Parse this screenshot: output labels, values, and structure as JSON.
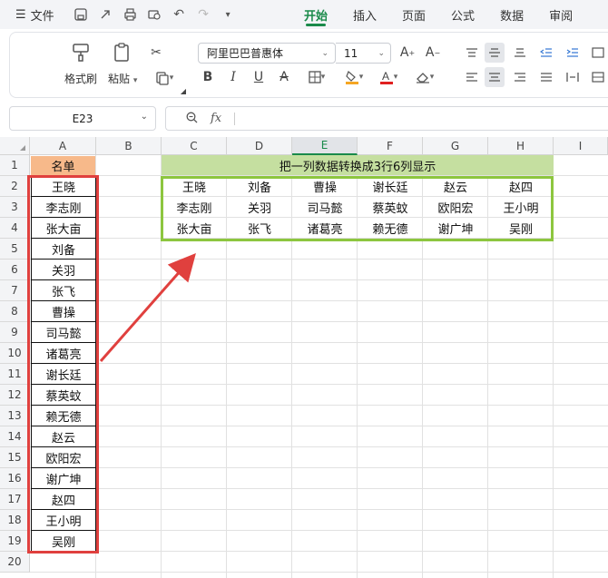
{
  "menubar": {
    "file_label": "文件",
    "tabs": [
      {
        "label": "开始",
        "active": true
      },
      {
        "label": "插入",
        "active": false
      },
      {
        "label": "页面",
        "active": false
      },
      {
        "label": "公式",
        "active": false
      },
      {
        "label": "数据",
        "active": false
      },
      {
        "label": "审阅",
        "active": false
      }
    ]
  },
  "ribbon": {
    "format_painter_label": "格式刷",
    "paste_label": "粘贴",
    "font_name": "阿里巴巴普惠体",
    "font_size": "11",
    "accent_color": "#1a8a4a"
  },
  "formula_bar": {
    "cell_ref": "E23",
    "fx_label": "fx",
    "formula": ""
  },
  "sheet": {
    "columns": [
      "A",
      "B",
      "C",
      "D",
      "E",
      "F",
      "G",
      "H",
      "I"
    ],
    "selected_column": "E",
    "rows": [
      "1",
      "2",
      "3",
      "4",
      "5",
      "6",
      "7",
      "8",
      "9",
      "10",
      "11",
      "12",
      "13",
      "14",
      "15",
      "16",
      "17",
      "18",
      "19",
      "20"
    ],
    "name_header": "名单",
    "names": [
      "王晓",
      "李志刚",
      "张大亩",
      "刘备",
      "关羽",
      "张飞",
      "曹操",
      "司马懿",
      "诸葛亮",
      "谢长廷",
      "蔡英蚊",
      "赖无德",
      "赵云",
      "欧阳宏",
      "谢广坤",
      "赵四",
      "王小明",
      "吴刚"
    ],
    "result_title": "把一列数据转换成3行6列显示",
    "result_rows": [
      [
        "王晓",
        "刘备",
        "曹操",
        "谢长廷",
        "赵云",
        "赵四"
      ],
      [
        "李志刚",
        "关羽",
        "司马懿",
        "蔡英蚊",
        "欧阳宏",
        "王小明"
      ],
      [
        "张大亩",
        "张飞",
        "诸葛亮",
        "赖无德",
        "谢广坤",
        "吴刚"
      ]
    ],
    "colors": {
      "name_header_fill": "#f7b98a",
      "title_fill": "#c5dfa0",
      "source_frame": "#e0403e",
      "result_frame": "#8dc63f",
      "arrow": "#e0403e"
    }
  }
}
